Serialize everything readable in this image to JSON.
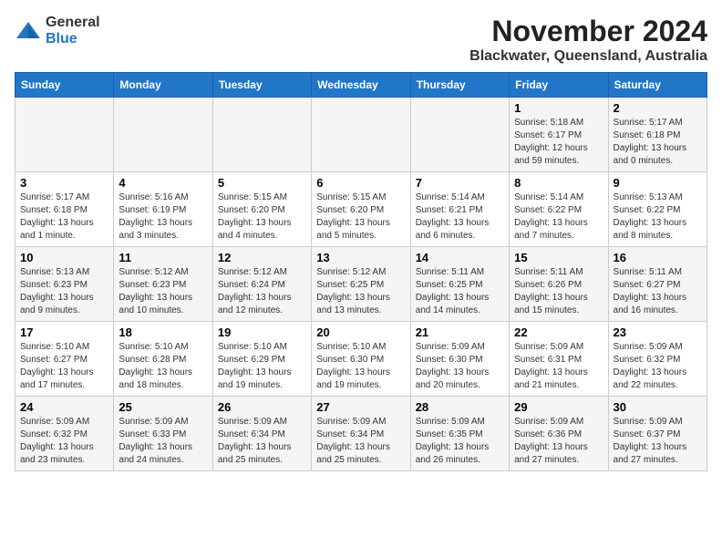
{
  "logo": {
    "text_general": "General",
    "text_blue": "Blue"
  },
  "title": "November 2024",
  "subtitle": "Blackwater, Queensland, Australia",
  "days_of_week": [
    "Sunday",
    "Monday",
    "Tuesday",
    "Wednesday",
    "Thursday",
    "Friday",
    "Saturday"
  ],
  "weeks": [
    [
      {
        "day": "",
        "info": ""
      },
      {
        "day": "",
        "info": ""
      },
      {
        "day": "",
        "info": ""
      },
      {
        "day": "",
        "info": ""
      },
      {
        "day": "",
        "info": ""
      },
      {
        "day": "1",
        "info": "Sunrise: 5:18 AM\nSunset: 6:17 PM\nDaylight: 12 hours and 59 minutes."
      },
      {
        "day": "2",
        "info": "Sunrise: 5:17 AM\nSunset: 6:18 PM\nDaylight: 13 hours and 0 minutes."
      }
    ],
    [
      {
        "day": "3",
        "info": "Sunrise: 5:17 AM\nSunset: 6:18 PM\nDaylight: 13 hours and 1 minute."
      },
      {
        "day": "4",
        "info": "Sunrise: 5:16 AM\nSunset: 6:19 PM\nDaylight: 13 hours and 3 minutes."
      },
      {
        "day": "5",
        "info": "Sunrise: 5:15 AM\nSunset: 6:20 PM\nDaylight: 13 hours and 4 minutes."
      },
      {
        "day": "6",
        "info": "Sunrise: 5:15 AM\nSunset: 6:20 PM\nDaylight: 13 hours and 5 minutes."
      },
      {
        "day": "7",
        "info": "Sunrise: 5:14 AM\nSunset: 6:21 PM\nDaylight: 13 hours and 6 minutes."
      },
      {
        "day": "8",
        "info": "Sunrise: 5:14 AM\nSunset: 6:22 PM\nDaylight: 13 hours and 7 minutes."
      },
      {
        "day": "9",
        "info": "Sunrise: 5:13 AM\nSunset: 6:22 PM\nDaylight: 13 hours and 8 minutes."
      }
    ],
    [
      {
        "day": "10",
        "info": "Sunrise: 5:13 AM\nSunset: 6:23 PM\nDaylight: 13 hours and 9 minutes."
      },
      {
        "day": "11",
        "info": "Sunrise: 5:12 AM\nSunset: 6:23 PM\nDaylight: 13 hours and 10 minutes."
      },
      {
        "day": "12",
        "info": "Sunrise: 5:12 AM\nSunset: 6:24 PM\nDaylight: 13 hours and 12 minutes."
      },
      {
        "day": "13",
        "info": "Sunrise: 5:12 AM\nSunset: 6:25 PM\nDaylight: 13 hours and 13 minutes."
      },
      {
        "day": "14",
        "info": "Sunrise: 5:11 AM\nSunset: 6:25 PM\nDaylight: 13 hours and 14 minutes."
      },
      {
        "day": "15",
        "info": "Sunrise: 5:11 AM\nSunset: 6:26 PM\nDaylight: 13 hours and 15 minutes."
      },
      {
        "day": "16",
        "info": "Sunrise: 5:11 AM\nSunset: 6:27 PM\nDaylight: 13 hours and 16 minutes."
      }
    ],
    [
      {
        "day": "17",
        "info": "Sunrise: 5:10 AM\nSunset: 6:27 PM\nDaylight: 13 hours and 17 minutes."
      },
      {
        "day": "18",
        "info": "Sunrise: 5:10 AM\nSunset: 6:28 PM\nDaylight: 13 hours and 18 minutes."
      },
      {
        "day": "19",
        "info": "Sunrise: 5:10 AM\nSunset: 6:29 PM\nDaylight: 13 hours and 19 minutes."
      },
      {
        "day": "20",
        "info": "Sunrise: 5:10 AM\nSunset: 6:30 PM\nDaylight: 13 hours and 19 minutes."
      },
      {
        "day": "21",
        "info": "Sunrise: 5:09 AM\nSunset: 6:30 PM\nDaylight: 13 hours and 20 minutes."
      },
      {
        "day": "22",
        "info": "Sunrise: 5:09 AM\nSunset: 6:31 PM\nDaylight: 13 hours and 21 minutes."
      },
      {
        "day": "23",
        "info": "Sunrise: 5:09 AM\nSunset: 6:32 PM\nDaylight: 13 hours and 22 minutes."
      }
    ],
    [
      {
        "day": "24",
        "info": "Sunrise: 5:09 AM\nSunset: 6:32 PM\nDaylight: 13 hours and 23 minutes."
      },
      {
        "day": "25",
        "info": "Sunrise: 5:09 AM\nSunset: 6:33 PM\nDaylight: 13 hours and 24 minutes."
      },
      {
        "day": "26",
        "info": "Sunrise: 5:09 AM\nSunset: 6:34 PM\nDaylight: 13 hours and 25 minutes."
      },
      {
        "day": "27",
        "info": "Sunrise: 5:09 AM\nSunset: 6:34 PM\nDaylight: 13 hours and 25 minutes."
      },
      {
        "day": "28",
        "info": "Sunrise: 5:09 AM\nSunset: 6:35 PM\nDaylight: 13 hours and 26 minutes."
      },
      {
        "day": "29",
        "info": "Sunrise: 5:09 AM\nSunset: 6:36 PM\nDaylight: 13 hours and 27 minutes."
      },
      {
        "day": "30",
        "info": "Sunrise: 5:09 AM\nSunset: 6:37 PM\nDaylight: 13 hours and 27 minutes."
      }
    ]
  ]
}
